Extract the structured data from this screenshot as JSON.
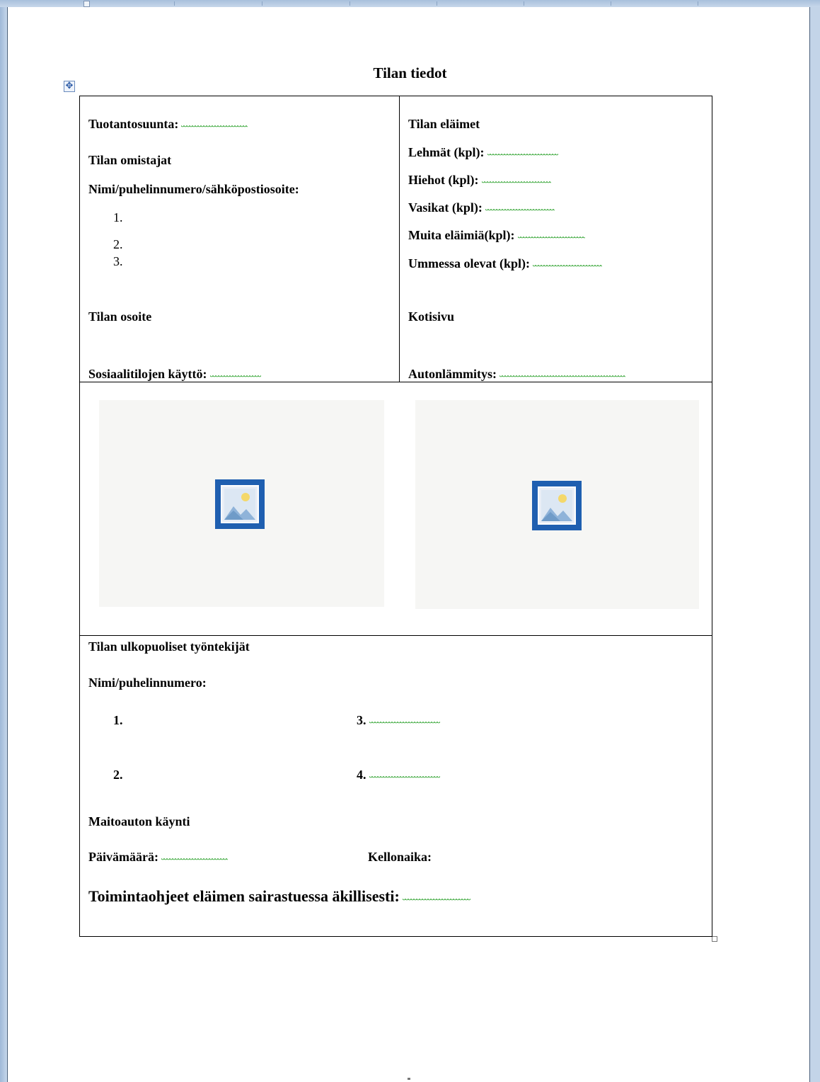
{
  "document": {
    "title": "Tilan tiedot",
    "left_column": {
      "production_label": "Tuotantosuunta:",
      "owners_heading": "Tilan omistajat",
      "owners_contact_label": "Nimi/puhelinnumero/sähköpostiosoite:",
      "owner_numbers": [
        "1.",
        "2.",
        "3."
      ],
      "address_label": "Tilan osoite",
      "social_facilities_label": "Sosiaalitilojen käyttö:"
    },
    "right_column": {
      "animals_heading": "Tilan eläimet",
      "cows_label": "Lehmät (kpl):",
      "heifers_label": "Hiehot (kpl):",
      "calves_label": "Vasikat (kpl):",
      "other_animals_label": "Muita eläimiä(kpl):",
      "dry_label": "Ummessa olevat (kpl):",
      "homepage_label": "Kotisivu",
      "car_heating_label": "Autonlämmitys:"
    },
    "pictures": [
      {
        "icon": "picture-placeholder-icon"
      },
      {
        "icon": "picture-placeholder-icon"
      }
    ],
    "workers": {
      "heading": "Tilan ulkopuoliset työntekijät",
      "contact_label": "Nimi/puhelinnumero:",
      "numbers": [
        "1.",
        "2.",
        "3.",
        "4."
      ]
    },
    "milk_truck": {
      "heading": "Maitoauton käynti",
      "date_label": "Päivämäärä:",
      "time_label": "Kellonaika:"
    },
    "instructions_label": "Toimintaohjeet eläimen sairastuessa äkillisesti:"
  },
  "colors": {
    "spellcheck_underline": "#2aa02a",
    "picture_icon": "#1f5fb0",
    "picture_background": "#f6f6f4",
    "window_background": "#c3d4e8"
  }
}
